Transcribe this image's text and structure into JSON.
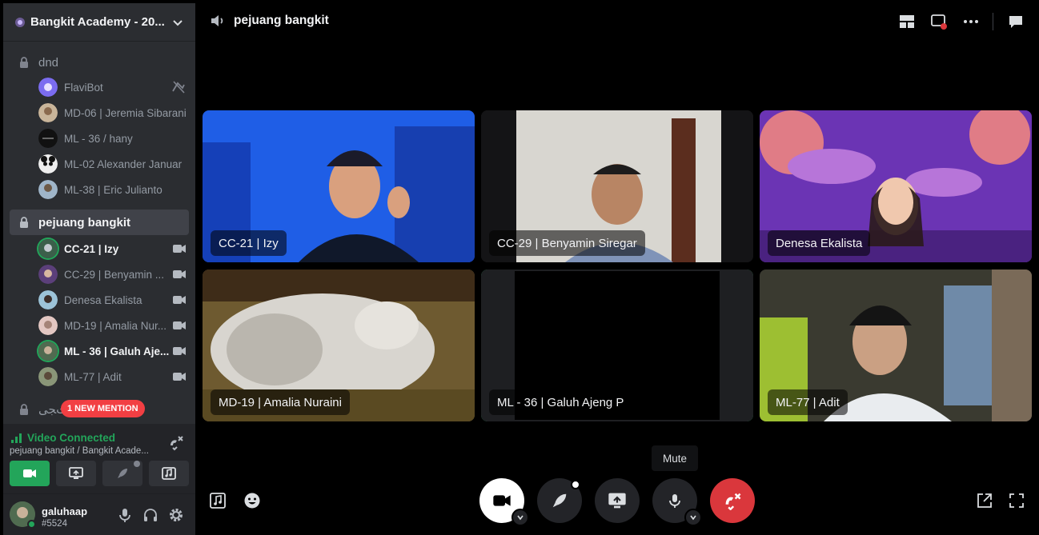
{
  "server": {
    "name": "Bangkit Academy - 20...",
    "icon": "server-icon"
  },
  "channels": [
    {
      "label": "dnd",
      "icon": "lock-icon",
      "active": false
    },
    {
      "label": "pejuang bangkit",
      "icon": "lock-icon",
      "active": true
    },
    {
      "label": "ﺕﺠﯽ",
      "icon": "lock-icon",
      "active": false
    }
  ],
  "dnd_members": [
    {
      "name": "FlaviBot",
      "icon": "bot-avatar"
    },
    {
      "name": "MD-06 | Jeremia Sibarani",
      "icon": "avatar"
    },
    {
      "name": "ML - 36 / hany",
      "icon": "avatar"
    },
    {
      "name": "ML-02 Alexander Januar",
      "icon": "panda-avatar"
    },
    {
      "name": "ML-38 | Eric Julianto",
      "icon": "avatar"
    }
  ],
  "voice_members": [
    {
      "name": "CC-21 | Izy",
      "bright": true
    },
    {
      "name": "CC-29 | Benyamin ...",
      "bright": false
    },
    {
      "name": "Denesa Ekalista",
      "bright": false
    },
    {
      "name": "MD-19 | Amalia Nur...",
      "bright": false
    },
    {
      "name": "ML - 36 | Galuh Aje...",
      "bright": true
    },
    {
      "name": "ML-77 | Adit",
      "bright": false
    }
  ],
  "mention_badge": "1 NEW MENTION",
  "voice_panel": {
    "status": "Video Connected",
    "sub": "pejuang bangkit / Bangkit Acade..."
  },
  "user": {
    "name": "galuhaap",
    "tag": "#5524"
  },
  "main": {
    "title": "pejuang bangkit",
    "tiles": [
      {
        "label": "CC-21 | Izy",
        "speaking": true
      },
      {
        "label": "CC-29 | Benyamin Siregar",
        "speaking": false
      },
      {
        "label": "Denesa Ekalista",
        "speaking": false
      },
      {
        "label": "MD-19 | Amalia Nuraini",
        "speaking": false
      },
      {
        "label": "ML - 36 | Galuh Ajeng P",
        "speaking": true
      },
      {
        "label": "ML-77 | Adit",
        "speaking": false
      }
    ],
    "tooltip": "Mute"
  },
  "colors": {
    "accent_green": "#23a55a",
    "danger_red": "#da373c",
    "sidebar_bg": "#2b2d31",
    "panel_bg": "#232428"
  }
}
